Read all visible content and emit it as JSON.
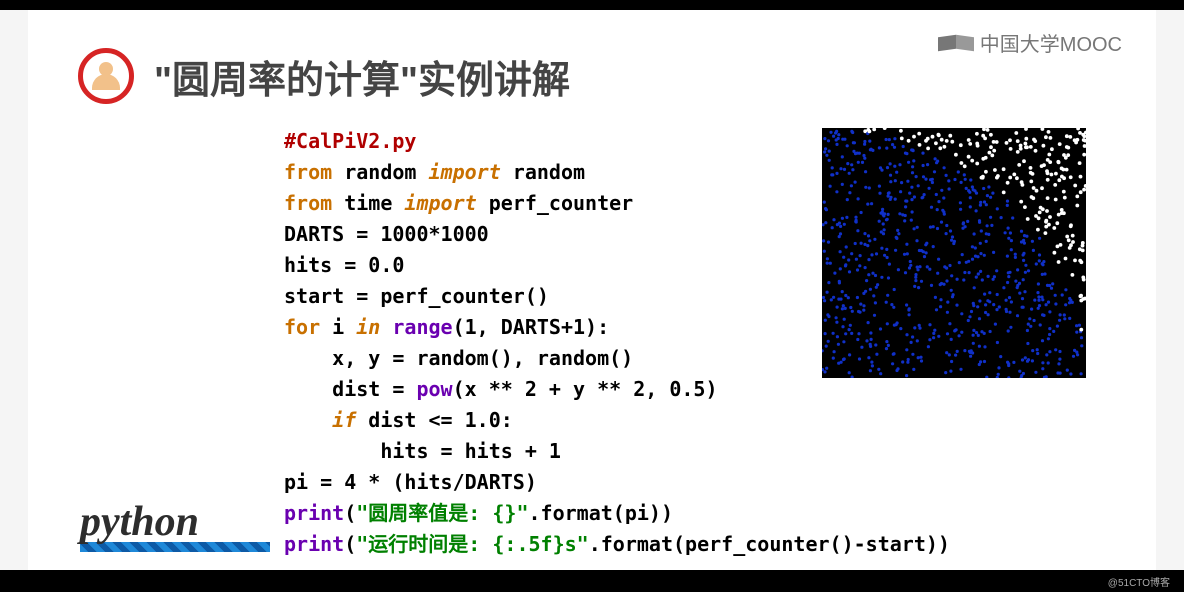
{
  "watermark": "@51CTO博客",
  "mooc_brand": "中国大学MOOC",
  "title": "\"圆周率的计算\"实例讲解",
  "python_logo_text": "python",
  "code": {
    "l1_comment": "#CalPiV2.py",
    "l2_from": "from",
    "l2_mod": " random ",
    "l2_import": "import",
    "l2_name": " random",
    "l3_from": "from",
    "l3_mod": " time ",
    "l3_import": "import",
    "l3_name": " perf_counter",
    "l4": "DARTS = 1000*1000",
    "l5": "hits = 0.0",
    "l6": "start = perf_counter()",
    "l7_for": "for",
    "l7_mid": " i ",
    "l7_in": "in",
    "l7_fn": " range",
    "l7_tail": "(1, DARTS+1):",
    "l8": "    x, y = random(), random()",
    "l9a": "    dist = ",
    "l9_fn": "pow",
    "l9b": "(x ** 2 + y ** 2, 0.5)",
    "l10_if": "    if",
    "l10_tail": " dist <= 1.0:",
    "l11": "        hits = hits + 1",
    "l12": "pi = 4 * (hits/DARTS)",
    "l13_fn": "print",
    "l13_a": "(",
    "l13_str": "\"圆周率值是: {}\"",
    "l13_b": ".format(pi))",
    "l14_fn": "print",
    "l14_a": "(",
    "l14_str": "\"运行时间是: {:.5f}s\"",
    "l14_b": ".format(perf_counter()-start))"
  }
}
